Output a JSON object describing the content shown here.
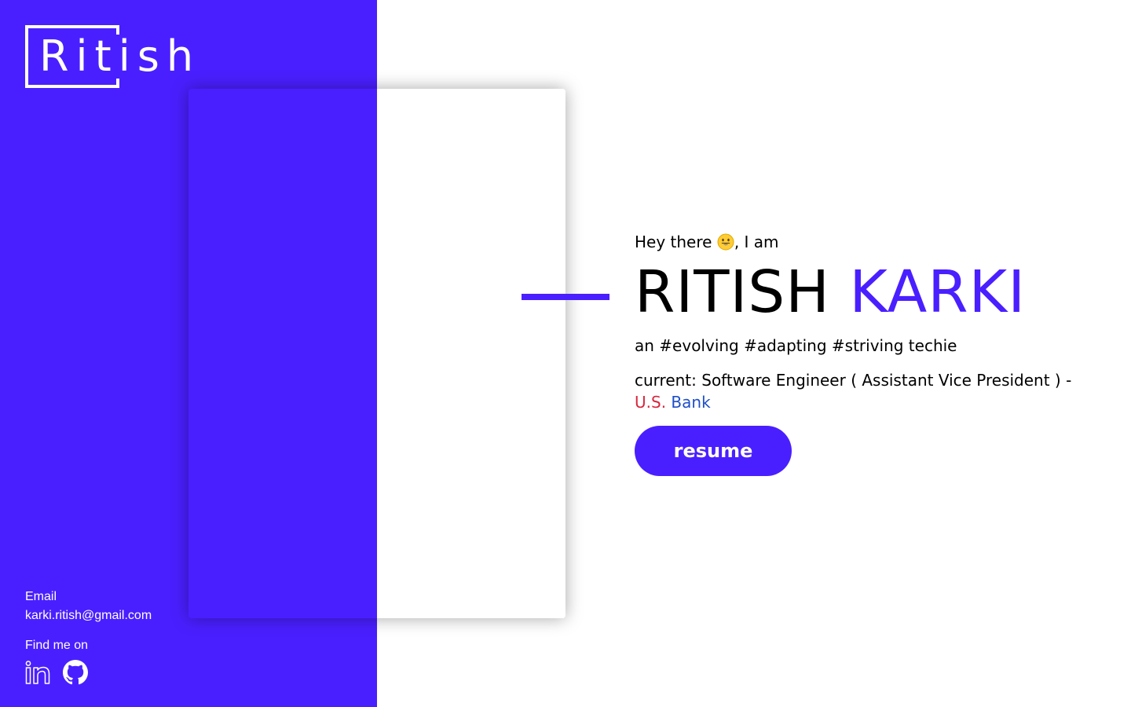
{
  "brand": {
    "logo_text": "Ritish",
    "primary_color": "#4a1fff"
  },
  "contact": {
    "email_label": "Email",
    "email_value": "karki.ritish@gmail.com",
    "find_label": "Find me on",
    "socials": [
      {
        "icon": "linkedin-icon",
        "name": "LinkedIn"
      },
      {
        "icon": "github-icon",
        "name": "GitHub"
      }
    ]
  },
  "intro": {
    "greeting_before": "Hey there ",
    "greeting_emoji": "grinning-face-emoji",
    "greeting_after": ", I am",
    "first_name": "RITISH",
    "last_name": "KARKI",
    "tagline": "an #evolving #adapting #striving techie",
    "current_prefix": "current: Software Engineer ( Assistant Vice President ) - ",
    "company_part1": "U.S.",
    "company_part2": "Bank",
    "company_colors": [
      "#d7263d",
      "#1f4fc7"
    ],
    "resume_label": "resume"
  }
}
